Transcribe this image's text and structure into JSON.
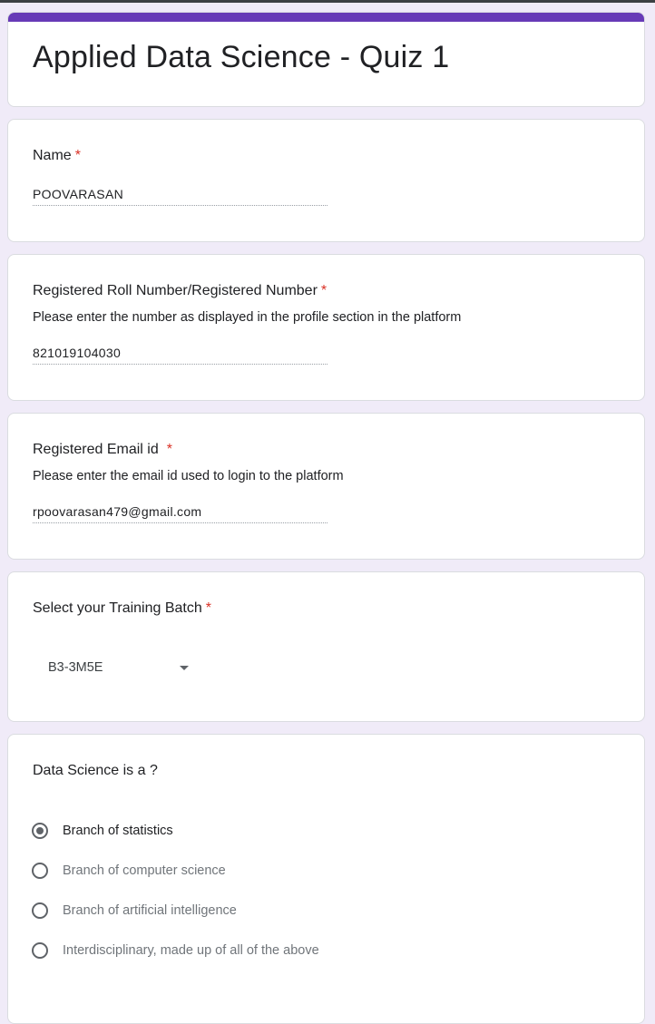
{
  "form": {
    "title": "Applied Data Science - Quiz 1",
    "accent_color": "#673ab7",
    "required_color": "#d93025"
  },
  "questions": {
    "name": {
      "title": "Name",
      "required_mark": "*",
      "value": "POOVARASAN"
    },
    "roll": {
      "title": "Registered Roll Number/Registered Number",
      "required_mark": "*",
      "description": "Please enter the number as displayed in the profile section in the platform",
      "value": "821019104030"
    },
    "email": {
      "title": "Registered Email id",
      "required_mark": "*",
      "description": "Please enter the email id used to login to the platform",
      "value": "rpoovarasan479@gmail.com"
    },
    "batch": {
      "title": "Select your Training Batch",
      "required_mark": "*",
      "selected": "B3-3M5E",
      "dropdown_icon": "caret-down-icon"
    },
    "mcq1": {
      "title": "Data Science is a ?",
      "options": [
        {
          "label": "Branch of statistics",
          "selected": true
        },
        {
          "label": "Branch of computer science",
          "selected": false
        },
        {
          "label": "Branch of artificial intelligence",
          "selected": false
        },
        {
          "label": "Interdisciplinary, made up of all of the above",
          "selected": false
        }
      ]
    }
  }
}
